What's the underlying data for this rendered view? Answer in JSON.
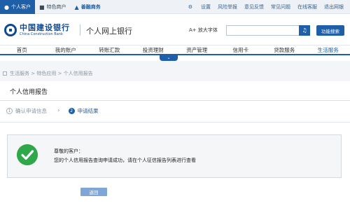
{
  "topbar": {
    "left": [
      {
        "label": "个人客户",
        "icon": "person-icon"
      },
      {
        "label": "特色商户",
        "icon": "merchant-icon"
      },
      {
        "label": "善融商务",
        "icon": "cart-icon"
      }
    ],
    "right": [
      "设置",
      "风险举报",
      "意见反馈",
      "常见问题",
      "在线客服",
      "退出网银"
    ]
  },
  "header": {
    "logo_cn": "中国建设银行",
    "logo_en": "China Construction Bank",
    "site_title": "个人网上银行",
    "font_size_label": "放大字体",
    "search_placeholder": "",
    "func_search_label": "功能搜索"
  },
  "nav": [
    "首页",
    "我的账户",
    "转账汇款",
    "投资理财",
    "资产管理",
    "信用卡",
    "贷款服务",
    "生活服务"
  ],
  "breadcrumb": [
    "生活服务",
    "特色应用",
    "个人信用报告"
  ],
  "page": {
    "title": "个人信用报告",
    "steps": [
      {
        "num": "1",
        "label": "确认申请信息"
      },
      {
        "num": "2",
        "label": "申请结果"
      }
    ],
    "message_title": "尊敬的客户：",
    "message_body": "您的个人信用报告查询申请成功，请在个人征信报告列表进行查看",
    "back_label": "返回"
  },
  "colors": {
    "brand": "#1e5fa8",
    "success": "#2ea84a"
  }
}
